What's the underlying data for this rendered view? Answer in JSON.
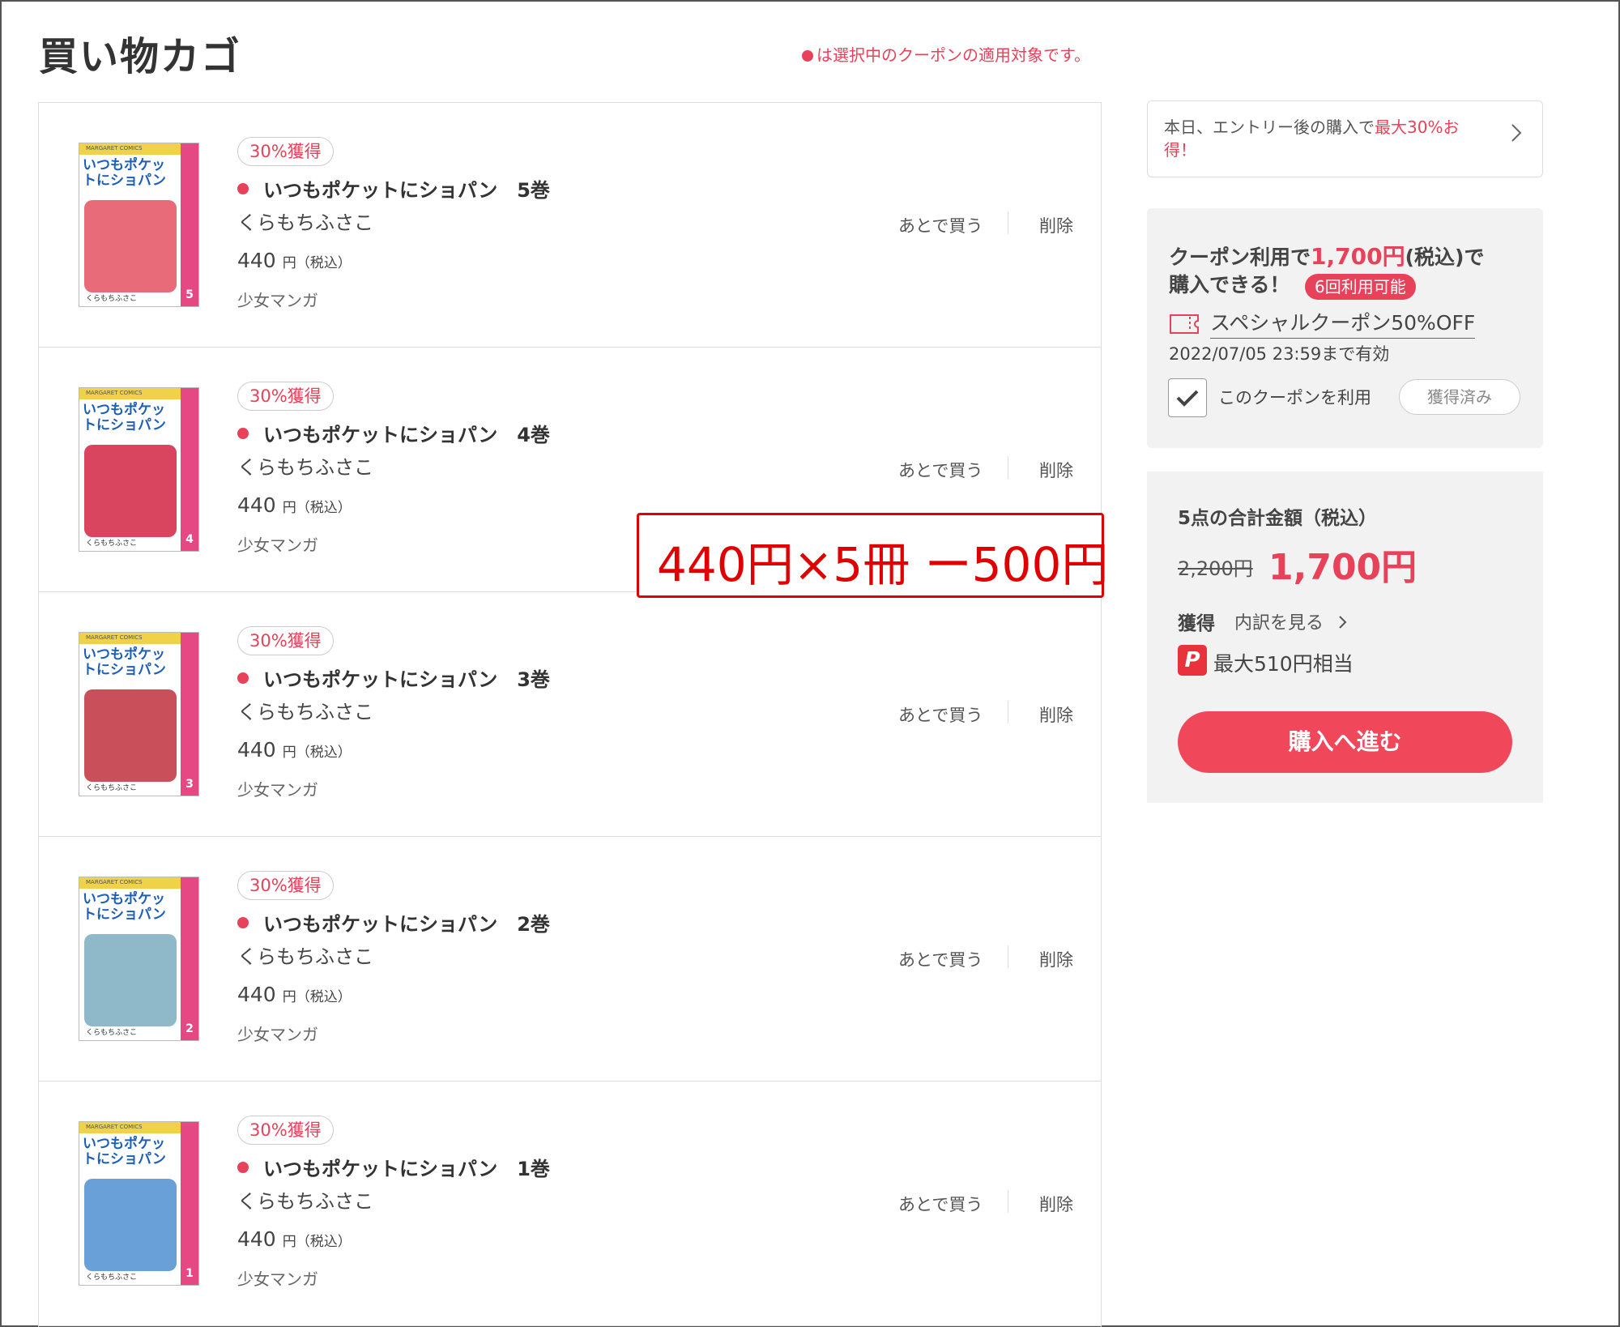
{
  "page": {
    "title": "買い物カゴ",
    "coupon_note": "は選択中のクーポンの適用対象です。"
  },
  "cart": {
    "items": [
      {
        "badge": "30%獲得",
        "title": "いつもポケットにショパン　5巻",
        "author": "くらもちふさこ",
        "price": "440",
        "price_unit": "円（税込）",
        "genre": "少女マンガ",
        "later": "あとで買う",
        "delete": "削除",
        "cover_title": "いつもポケットにショパン",
        "cover_volume": "5",
        "cover_author": "くらもちふさこ",
        "cover_top": "MARGARET COMICS",
        "cover_color": "#e86b7a"
      },
      {
        "badge": "30%獲得",
        "title": "いつもポケットにショパン　4巻",
        "author": "くらもちふさこ",
        "price": "440",
        "price_unit": "円（税込）",
        "genre": "少女マンガ",
        "later": "あとで買う",
        "delete": "削除",
        "cover_title": "いつもポケットにショパン",
        "cover_volume": "4",
        "cover_author": "くらもちふさこ",
        "cover_top": "MARGARET COMICS",
        "cover_color": "#d9455e"
      },
      {
        "badge": "30%獲得",
        "title": "いつもポケットにショパン　3巻",
        "author": "くらもちふさこ",
        "price": "440",
        "price_unit": "円（税込）",
        "genre": "少女マンガ",
        "later": "あとで買う",
        "delete": "削除",
        "cover_title": "いつもポケットにショパン",
        "cover_volume": "3",
        "cover_author": "くらもちふさこ",
        "cover_top": "MARGARET COMICS",
        "cover_color": "#c9505a"
      },
      {
        "badge": "30%獲得",
        "title": "いつもポケットにショパン　2巻",
        "author": "くらもちふさこ",
        "price": "440",
        "price_unit": "円（税込）",
        "genre": "少女マンガ",
        "later": "あとで買う",
        "delete": "削除",
        "cover_title": "いつもポケットにショパン",
        "cover_volume": "2",
        "cover_author": "くらもちふさこ",
        "cover_top": "MARGARET COMICS",
        "cover_color": "#8fb8c9"
      },
      {
        "badge": "30%獲得",
        "title": "いつもポケットにショパン　1巻",
        "author": "くらもちふさこ",
        "price": "440",
        "price_unit": "円（税込）",
        "genre": "少女マンガ",
        "later": "あとで買う",
        "delete": "削除",
        "cover_title": "いつもポケットにショパン",
        "cover_volume": "1",
        "cover_author": "くらもちふさこ",
        "cover_top": "MARGARET COMICS",
        "cover_color": "#6aa0d8"
      }
    ]
  },
  "annotation": {
    "text": "440円×5冊 ー500円"
  },
  "promo": {
    "text": "本日、エントリー後の購入で",
    "highlight": "最大30%お得！"
  },
  "coupon": {
    "line1_prefix": "クーポン利用で",
    "line1_amount": "1,700円",
    "line1_suffix": "(税込)で",
    "line2": "購入できる！",
    "uses_badge": "6回利用可能",
    "name": "スペシャルクーポン50%OFF",
    "expiry": "2022/07/05 23:59まで有効",
    "checkbox_label": "このクーポンを利用",
    "obtained_button": "獲得済み"
  },
  "summary": {
    "title": "5点の合計金額（税込）",
    "original_price": "2,200円",
    "total": "1,700円",
    "earn_label": "獲得",
    "breakdown_link": "内訳を見る",
    "paypay_icon": "P",
    "paypay_text": "最大510円相当",
    "buy_button": "購入へ進む"
  },
  "colors": {
    "accent": "#e8425a",
    "annotation": "#e00000"
  }
}
